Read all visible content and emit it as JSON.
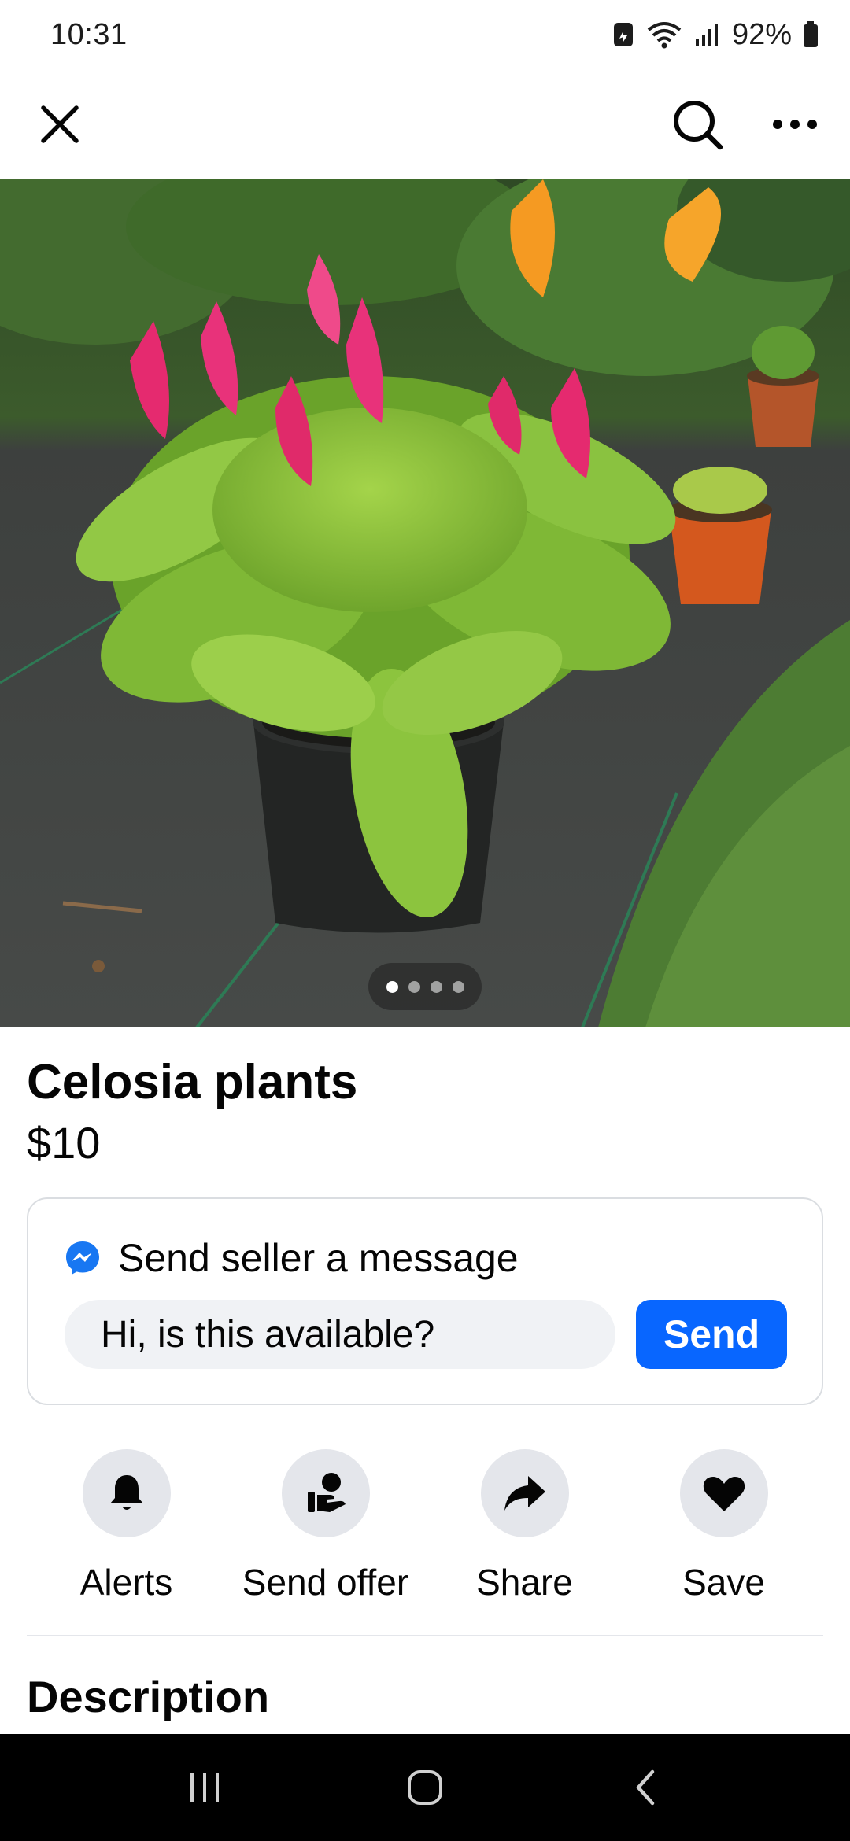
{
  "status_bar": {
    "time": "10:31",
    "battery": "92%"
  },
  "toolbar": {
    "close_icon": "close-icon",
    "search_icon": "search-icon",
    "more_icon": "more-icon"
  },
  "photo": {
    "pager": {
      "count": 4,
      "active_index": 0
    }
  },
  "listing": {
    "title": "Celosia plants",
    "price": "$10"
  },
  "message": {
    "header": "Send seller a message",
    "input_value": "Hi, is this available?",
    "send_label": "Send"
  },
  "actions": [
    {
      "label": "Alerts",
      "icon": "bell-icon"
    },
    {
      "label": "Send offer",
      "icon": "offer-icon"
    },
    {
      "label": "Share",
      "icon": "share-icon"
    },
    {
      "label": "Save",
      "icon": "heart-icon"
    }
  ],
  "description": {
    "title": "Description"
  },
  "colors": {
    "accent": "#0866ff",
    "messenger": "#1877f2",
    "chip_bg": "#e4e6eb",
    "input_bg": "#f0f2f5"
  }
}
